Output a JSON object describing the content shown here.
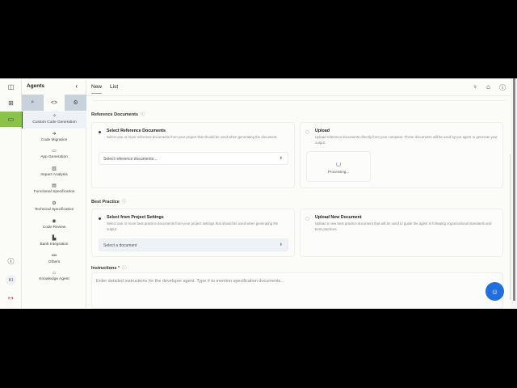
{
  "rail": {
    "avatar": "KI"
  },
  "panel": {
    "title": "Agents",
    "items": [
      {
        "label": "Custom Code Generation",
        "icon": "✧"
      },
      {
        "label": "Code Migration",
        "icon": "➔"
      },
      {
        "label": "App Generation",
        "icon": "▭"
      },
      {
        "label": "Impact Analysis",
        "icon": "▥"
      },
      {
        "label": "Functional Specification",
        "icon": "▤"
      },
      {
        "label": "Technical Specification",
        "icon": "⚙"
      },
      {
        "label": "Code Review",
        "icon": "◉"
      },
      {
        "label": "Bank Integration",
        "icon": "▙"
      },
      {
        "label": "Others",
        "icon": "•••"
      },
      {
        "label": "Knowledge Agent",
        "icon": "⌂"
      }
    ]
  },
  "tabs": [
    "New",
    "List"
  ],
  "ref": {
    "title": "Reference Documents",
    "select_title": "Select Reference Documents",
    "select_desc": "Select one or more reference documents from your project that should be used when generating the document.",
    "placeholder": "Select reference documents...",
    "upload_title": "Upload",
    "upload_desc": "Upload reference documents directly from your computer. These documents will be used by our agent to generate your output.",
    "processing": "Processing..."
  },
  "bp": {
    "title": "Best Practice",
    "select_title": "Select from Project Settings",
    "select_desc": "Select one or more best practice documents from your project settings that should be used when generating the output.",
    "placeholder": "Select a document",
    "upload_title": "Upload New Document",
    "upload_desc": "Upload a new best practice document that will be used to guide the agent in following organizational standards and best practices."
  },
  "instr": {
    "label": "Instructions",
    "required": "*",
    "placeholder": "Enter detailed instructions for the developer agent. Type # to mention specification documents..."
  }
}
